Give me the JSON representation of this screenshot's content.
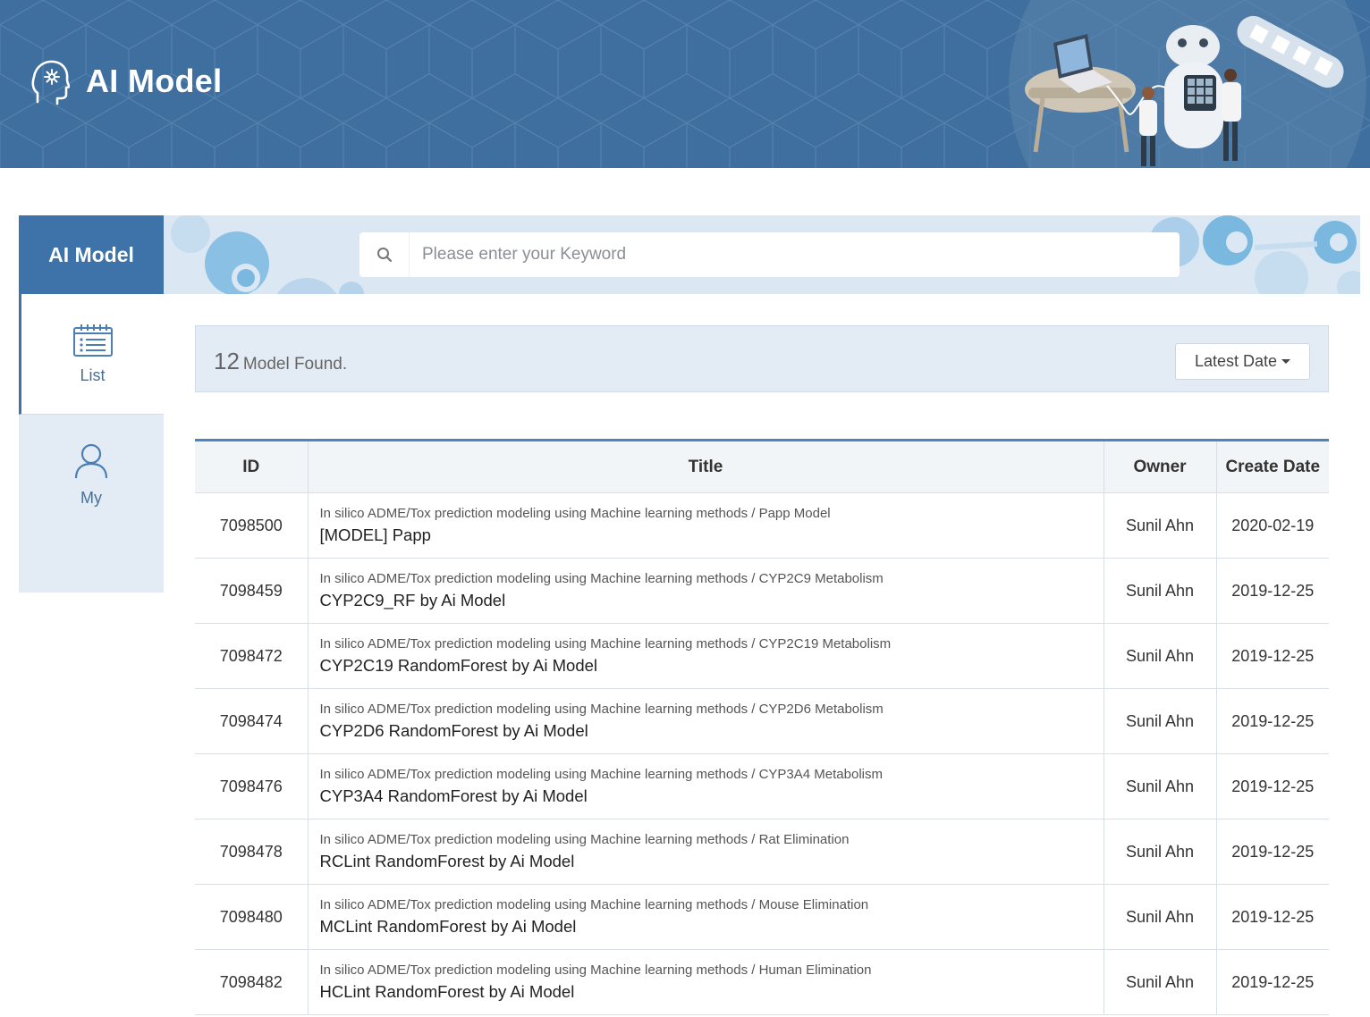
{
  "banner": {
    "title": "AI Model",
    "brand_icon": "brain-head-icon",
    "background_color": "#3f6f9e"
  },
  "sidebar": {
    "header": "AI Model",
    "items": [
      {
        "label": "List",
        "icon": "list-icon",
        "active": true
      },
      {
        "label": "My",
        "icon": "user-icon",
        "active": false
      }
    ]
  },
  "search": {
    "placeholder": "Please enter your Keyword",
    "value": "",
    "icon": "search-icon"
  },
  "results": {
    "count": "12",
    "count_label": "Model Found.",
    "sort_label": "Latest Date"
  },
  "table": {
    "headers": [
      "ID",
      "Title",
      "Owner",
      "Create Date"
    ],
    "rows": [
      {
        "id": "7098500",
        "subtitle": "In silico ADME/Tox prediction modeling using Machine learning methods / Papp Model",
        "title": "[MODEL] Papp",
        "owner": "Sunil Ahn",
        "date": "2020-02-19"
      },
      {
        "id": "7098459",
        "subtitle": "In silico ADME/Tox prediction modeling using Machine learning methods / CYP2C9 Metabolism",
        "title": "CYP2C9_RF by Ai Model",
        "owner": "Sunil Ahn",
        "date": "2019-12-25"
      },
      {
        "id": "7098472",
        "subtitle": "In silico ADME/Tox prediction modeling using Machine learning methods / CYP2C19 Metabolism",
        "title": "CYP2C19 RandomForest by Ai Model",
        "owner": "Sunil Ahn",
        "date": "2019-12-25"
      },
      {
        "id": "7098474",
        "subtitle": "In silico ADME/Tox prediction modeling using Machine learning methods / CYP2D6 Metabolism",
        "title": "CYP2D6 RandomForest by Ai Model",
        "owner": "Sunil Ahn",
        "date": "2019-12-25"
      },
      {
        "id": "7098476",
        "subtitle": "In silico ADME/Tox prediction modeling using Machine learning methods / CYP3A4 Metabolism",
        "title": "CYP3A4 RandomForest by Ai Model",
        "owner": "Sunil Ahn",
        "date": "2019-12-25"
      },
      {
        "id": "7098478",
        "subtitle": "In silico ADME/Tox prediction modeling using Machine learning methods / Rat Elimination",
        "title": "RCLint RandomForest by Ai Model",
        "owner": "Sunil Ahn",
        "date": "2019-12-25"
      },
      {
        "id": "7098480",
        "subtitle": "In silico ADME/Tox prediction modeling using Machine learning methods / Mouse Elimination",
        "title": "MCLint RandomForest by Ai Model",
        "owner": "Sunil Ahn",
        "date": "2019-12-25"
      },
      {
        "id": "7098482",
        "subtitle": "In silico ADME/Tox prediction modeling using Machine learning methods / Human Elimination",
        "title": "HCLint RandomForest by Ai Model",
        "owner": "Sunil Ahn",
        "date": "2019-12-25"
      }
    ]
  }
}
